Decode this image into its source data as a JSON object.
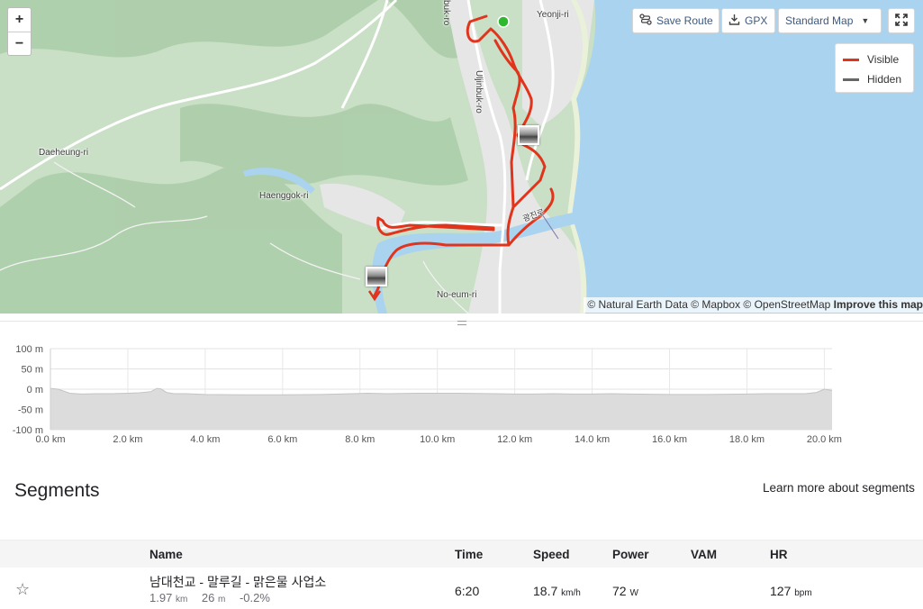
{
  "map": {
    "zoom_in": "+",
    "zoom_out": "−",
    "labels": {
      "yeonji": "Yeonji-ri",
      "uljinbuk": "Uljinbuk-ro",
      "uljinbuk_top": "buk-ro",
      "daeheung": "Daeheung-ri",
      "haenggok": "Haenggok-ri",
      "noeum": "No-eum-ri",
      "road_kr": "광진로"
    },
    "buttons": {
      "save_route": "Save Route",
      "gpx": "GPX",
      "map_style": "Standard Map"
    },
    "icons": {
      "save_route": "route-icon",
      "gpx": "download-icon",
      "map_style": "caret-down-icon",
      "fullscreen": "fullscreen-icon"
    },
    "legend": {
      "visible_label": "Visible",
      "visible_color": "#e0341c",
      "hidden_label": "Hidden",
      "hidden_color": "#666666"
    },
    "attribution": {
      "sources": "© Natural Earth Data © Mapbox © OpenStreetMap",
      "improve": "Improve this map"
    }
  },
  "elevation": {
    "y_ticks": [
      "100 m",
      "50 m",
      "0 m",
      "-50 m",
      "-100 m"
    ],
    "x_ticks": [
      "0.0 km",
      "2.0 km",
      "4.0 km",
      "6.0 km",
      "8.0 km",
      "10.0 km",
      "12.0 km",
      "14.0 km",
      "16.0 km",
      "18.0 km",
      "20.0 km"
    ]
  },
  "chart_data": {
    "type": "area",
    "title": "",
    "xlabel": "",
    "ylabel": "",
    "xlim": [
      0,
      20.2
    ],
    "ylim": [
      -100,
      100
    ],
    "grid": true,
    "x": [
      0,
      0.2,
      0.5,
      0.8,
      1.2,
      1.6,
      2.0,
      2.3,
      2.6,
      2.75,
      2.85,
      3.0,
      3.2,
      3.5,
      4.0,
      5.0,
      6.0,
      7.0,
      7.8,
      8.2,
      8.7,
      9.5,
      10.5,
      11.5,
      12.0,
      12.5,
      13.0,
      13.5,
      14.0,
      14.5,
      15.0,
      16.0,
      17.0,
      18.0,
      18.5,
      19.0,
      19.5,
      19.8,
      20.0,
      20.2
    ],
    "values": [
      2,
      0,
      -10,
      -12,
      -11,
      -11,
      -10,
      -9,
      -6,
      2,
      1,
      -8,
      -11,
      -11,
      -13,
      -14,
      -14,
      -13,
      -11,
      -10,
      -11,
      -10,
      -10,
      -11,
      -12,
      -12,
      -11,
      -12,
      -12,
      -11,
      -12,
      -13,
      -13,
      -12,
      -11,
      -11,
      -11,
      -8,
      0,
      -3
    ]
  },
  "segments": {
    "title": "Segments",
    "learn_more": "Learn more about segments",
    "headers": {
      "name": "Name",
      "time": "Time",
      "speed": "Speed",
      "power": "Power",
      "vam": "VAM",
      "hr": "HR"
    },
    "rows": [
      {
        "star": "☆",
        "name": "남대천교 - 말루길 - 맑은물 사업소",
        "distance": "1.97",
        "distance_unit": "km",
        "elev_gain": "26",
        "elev_unit": "m",
        "grade": "-0.2%",
        "time": "6:20",
        "speed": "18.7",
        "speed_unit": "km/h",
        "power": "72",
        "power_unit": "W",
        "vam": "",
        "hr": "127",
        "hr_unit": "bpm"
      }
    ]
  }
}
